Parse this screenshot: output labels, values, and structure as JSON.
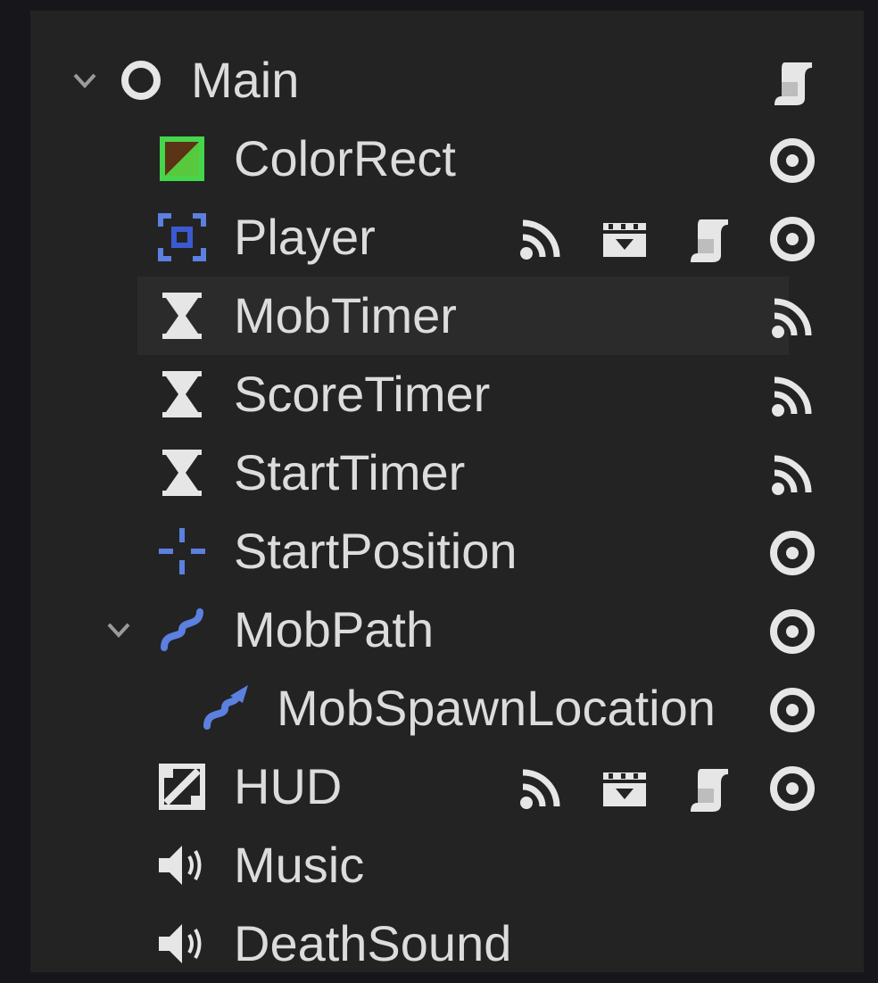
{
  "scene_tree": {
    "nodes": [
      {
        "name": "Main",
        "icon": "node-circle-icon",
        "depth": 0,
        "expanded": true,
        "status_icons": [
          "script-icon"
        ]
      },
      {
        "name": "ColorRect",
        "icon": "color-rect-icon",
        "depth": 1,
        "status_icons": [
          "visibility-icon"
        ]
      },
      {
        "name": "Player",
        "icon": "area2d-icon",
        "depth": 1,
        "status_icons": [
          "signal-icon",
          "clapperboard-icon",
          "script-icon",
          "visibility-icon"
        ]
      },
      {
        "name": "MobTimer",
        "icon": "timer-icon",
        "depth": 1,
        "hovered": true,
        "status_icons": [
          "signal-icon"
        ]
      },
      {
        "name": "ScoreTimer",
        "icon": "timer-icon",
        "depth": 1,
        "status_icons": [
          "signal-icon"
        ]
      },
      {
        "name": "StartTimer",
        "icon": "timer-icon",
        "depth": 1,
        "status_icons": [
          "signal-icon"
        ]
      },
      {
        "name": "StartPosition",
        "icon": "marker2d-icon",
        "depth": 1,
        "status_icons": [
          "visibility-icon"
        ]
      },
      {
        "name": "MobPath",
        "icon": "path2d-icon",
        "depth": 1,
        "expanded": true,
        "status_icons": [
          "visibility-icon"
        ]
      },
      {
        "name": "MobSpawnLocation",
        "icon": "path-follow-icon",
        "depth": 2,
        "status_icons": [
          "visibility-icon"
        ]
      },
      {
        "name": "HUD",
        "icon": "canvas-layer-icon",
        "depth": 1,
        "status_icons": [
          "signal-icon",
          "clapperboard-icon",
          "script-icon",
          "visibility-icon"
        ]
      },
      {
        "name": "Music",
        "icon": "audio-player-icon",
        "depth": 1,
        "status_icons": []
      },
      {
        "name": "DeathSound",
        "icon": "audio-player-icon",
        "depth": 1,
        "status_icons": []
      }
    ]
  },
  "colors": {
    "background": "#232323",
    "text": "#dcdcdc",
    "hover": "#2b2b2b",
    "color_rect_green": "#45d64b",
    "node2d_blue": "#5b80e0"
  }
}
